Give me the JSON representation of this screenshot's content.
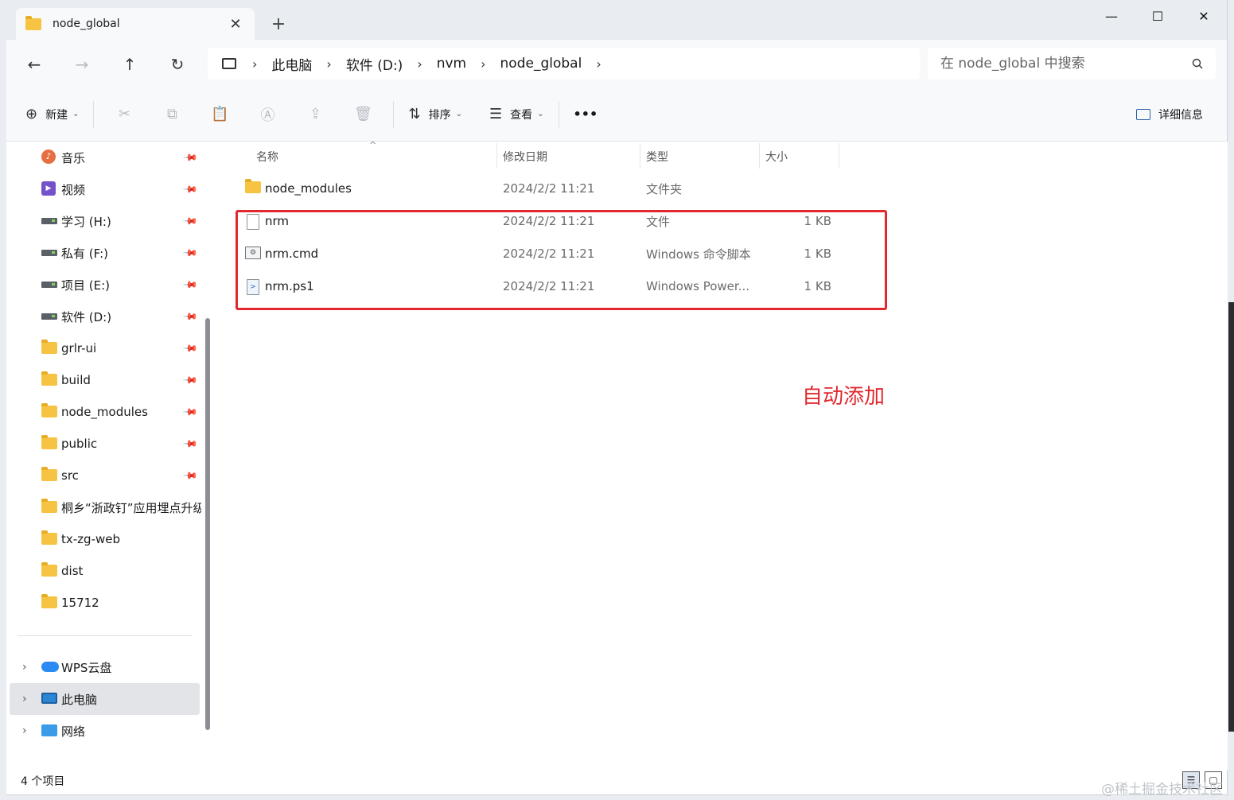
{
  "tab": {
    "title": "node_global",
    "close": "✕",
    "new": "+"
  },
  "window_controls": {
    "minimize": "—",
    "maximize": "☐",
    "close": "✕"
  },
  "nav": {
    "back": "←",
    "forward": "→",
    "up": "↑",
    "refresh": "↻"
  },
  "breadcrumb": [
    "此电脑",
    "软件 (D:)",
    "nvm",
    "node_global"
  ],
  "search": {
    "placeholder": "在 node_global 中搜索"
  },
  "toolbar": {
    "new_label": "新建",
    "sort_label": "排序",
    "view_label": "查看",
    "more_label": "•••",
    "details_label": "详细信息"
  },
  "sidebar": {
    "quick_access": [
      {
        "label": "音乐",
        "icon": "music-icon"
      },
      {
        "label": "视频",
        "icon": "video-icon"
      },
      {
        "label": "学习 (H:)",
        "icon": "drive-icon"
      },
      {
        "label": "私有 (F:)",
        "icon": "drive-icon"
      },
      {
        "label": "项目 (E:)",
        "icon": "drive-icon"
      },
      {
        "label": "软件 (D:)",
        "icon": "drive-icon"
      },
      {
        "label": "grlr-ui",
        "icon": "folder-icon"
      },
      {
        "label": "build",
        "icon": "folder-icon"
      },
      {
        "label": "node_modules",
        "icon": "folder-icon"
      },
      {
        "label": "public",
        "icon": "folder-icon"
      },
      {
        "label": "src",
        "icon": "folder-icon"
      },
      {
        "label": "桐乡“浙政钉”应用埋点升级",
        "icon": "folder-icon"
      },
      {
        "label": "tx-zg-web",
        "icon": "folder-icon"
      },
      {
        "label": "dist",
        "icon": "folder-icon"
      },
      {
        "label": "15712",
        "icon": "folder-icon"
      }
    ],
    "locations": [
      {
        "label": "WPS云盘",
        "icon": "cloud-icon"
      },
      {
        "label": "此电脑",
        "icon": "computer-icon",
        "selected": true
      },
      {
        "label": "网络",
        "icon": "network-icon"
      }
    ]
  },
  "columns": {
    "name": "名称",
    "date": "修改日期",
    "type": "类型",
    "size": "大小"
  },
  "files": [
    {
      "name": "node_modules",
      "date": "2024/2/2 11:21",
      "type": "文件夹",
      "size": "",
      "icon": "folder-icon"
    },
    {
      "name": "nrm",
      "date": "2024/2/2 11:21",
      "type": "文件",
      "size": "1 KB",
      "icon": "file-icon"
    },
    {
      "name": "nrm.cmd",
      "date": "2024/2/2 11:21",
      "type": "Windows 命令脚本",
      "size": "1 KB",
      "icon": "cmd-script-icon"
    },
    {
      "name": "nrm.ps1",
      "date": "2024/2/2 11:21",
      "type": "Windows Power...",
      "size": "1 KB",
      "icon": "powershell-icon"
    }
  ],
  "annotation": "自动添加",
  "status": "4 个项目",
  "watermark": "@稀土掘金技术社区",
  "colors": {
    "highlight": "#e0282d",
    "folder": "#f6c343",
    "selected": "#e2e4e8"
  }
}
